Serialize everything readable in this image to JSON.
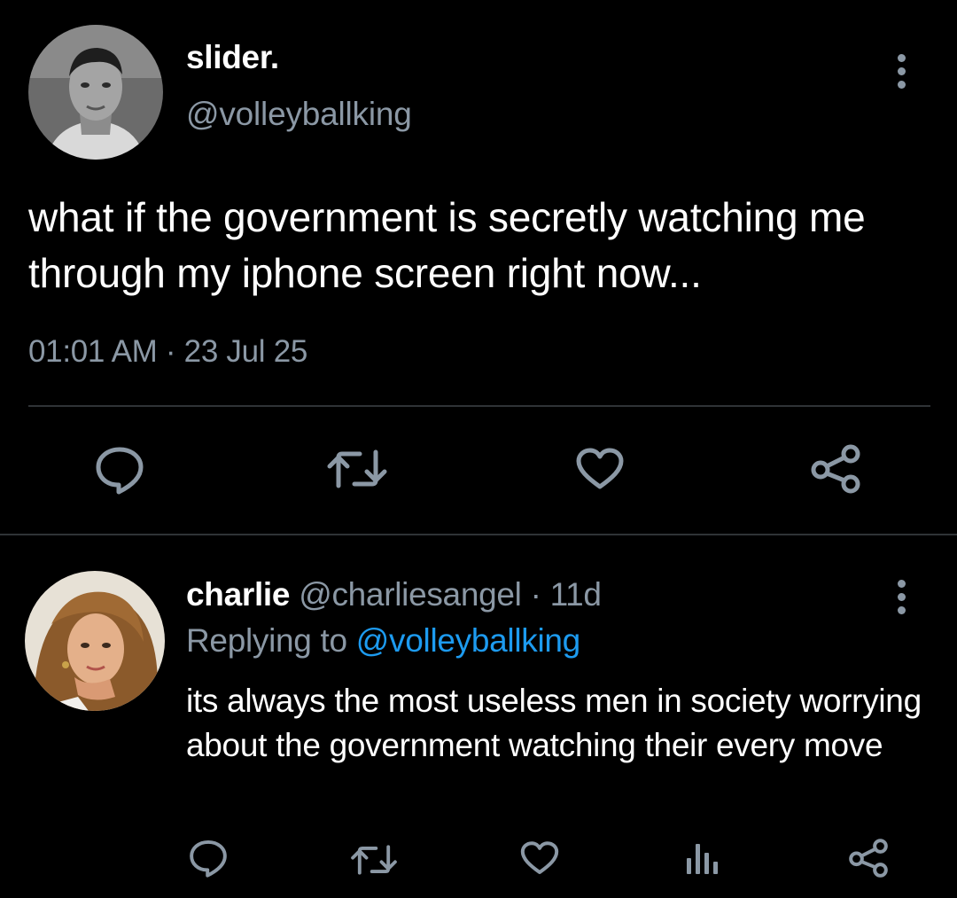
{
  "main_tweet": {
    "display_name": "slider.",
    "handle": "@volleyballking",
    "text": "what if the government is secretly watching me through my iphone screen right now...",
    "timestamp": "01:01 AM · 23 Jul 25",
    "icons": {
      "more": "more-vertical-icon",
      "reply": "reply-icon",
      "retweet": "retweet-icon",
      "like": "heart-icon",
      "share": "share-icon"
    }
  },
  "reply_tweet": {
    "display_name": "charlie",
    "handle": "@charliesangel",
    "separator": "·",
    "time": "11d",
    "replying_to_prefix": "Replying to",
    "replying_to_handle": "@volleyballking",
    "text": "its always the most useless men in society worrying about the government watching their every move",
    "icons": {
      "more": "more-vertical-icon",
      "reply": "reply-icon",
      "retweet": "retweet-icon",
      "like": "heart-icon",
      "analytics": "analytics-icon",
      "share": "share-icon"
    }
  },
  "colors": {
    "background": "#000000",
    "text_primary": "#ffffff",
    "text_secondary": "#8b98a5",
    "link": "#1d9bf0",
    "divider": "#2f3336"
  }
}
